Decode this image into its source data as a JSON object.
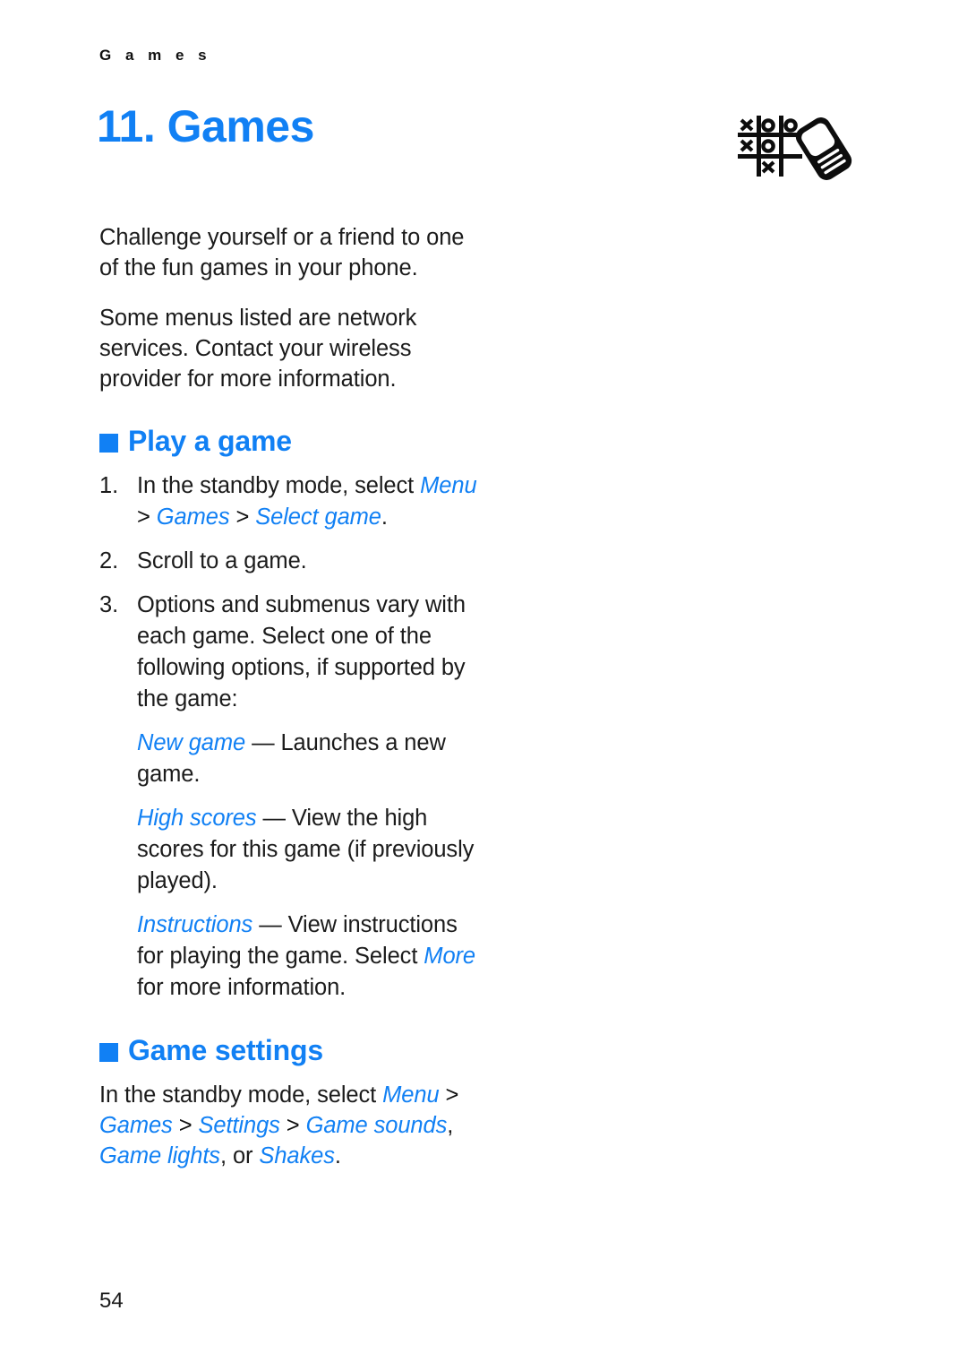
{
  "page": {
    "running_head": "G a m e s",
    "chapter_title": "11. Games",
    "page_number": "54",
    "accent_color": "#1180f4",
    "text_color": "#1b1b1b"
  },
  "icon": {
    "name": "tictactoe-phone-icon",
    "grid_marks": [
      "X",
      "O",
      "O",
      "X",
      "O",
      "",
      "",
      "X",
      ""
    ]
  },
  "intro": {
    "paragraph_1": "Challenge yourself or a friend to one of the fun games in your phone.",
    "paragraph_2": "Some menus listed are network services. Contact your wireless provider for more information."
  },
  "play_a_game": {
    "heading": "Play a game",
    "steps": [
      {
        "number": "1.",
        "text_before": "In the standby mode, select ",
        "menu_path": [
          "Menu",
          "Games",
          "Select game"
        ],
        "separator": " > ",
        "text_after": "."
      },
      {
        "number": "2.",
        "text_before": "Scroll to a game.",
        "menu_path": [],
        "separator": "",
        "text_after": ""
      },
      {
        "number": "3.",
        "text_before": "Options and submenus vary with each game. Select one of the following options, if supported by the game:",
        "menu_path": [],
        "separator": "",
        "text_after": ""
      }
    ],
    "options": [
      {
        "term": "New game",
        "dash": " — ",
        "description": "Launches a new game.",
        "description_tail": "",
        "inline_term": ""
      },
      {
        "term": "High scores",
        "dash": " — ",
        "description": "View the high scores for this game (if previously played).",
        "description_tail": "",
        "inline_term": ""
      },
      {
        "term": "Instructions",
        "dash": " — ",
        "description": "View instructions for playing the game. Select ",
        "inline_term": "More",
        "description_tail": " for more information."
      }
    ]
  },
  "game_settings": {
    "heading": "Game settings",
    "text_before": "In the standby mode, select ",
    "menu_path": [
      "Menu",
      "Games",
      "Settings",
      "Game sounds"
    ],
    "separator": " > ",
    "tail_comma": ", ",
    "option_2": "Game lights",
    "tail_or": ", or ",
    "option_3": "Shakes",
    "text_after": "."
  }
}
